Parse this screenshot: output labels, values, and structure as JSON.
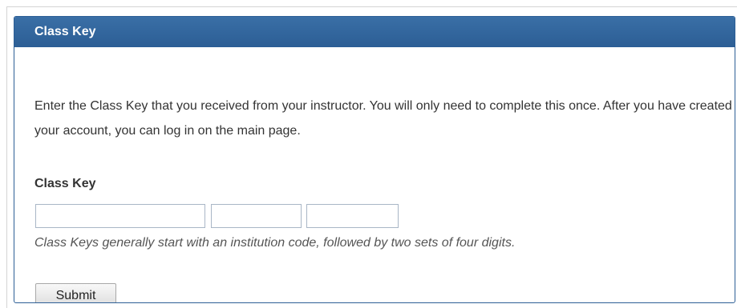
{
  "panel": {
    "title": "Class Key",
    "description": "Enter the Class Key that you received from your instructor. You will only need to complete this once. After you have created your account, you can log in on the main page.",
    "field_label": "Class Key",
    "inputs": [
      {
        "value": "",
        "placeholder": ""
      },
      {
        "value": "",
        "placeholder": ""
      },
      {
        "value": "",
        "placeholder": ""
      }
    ],
    "hint": "Class Keys generally start with an institution code, followed by two sets of four digits.",
    "submit_label": "Submit"
  },
  "colors": {
    "header_bg": "#30659d",
    "header_text": "#ffffff",
    "border": "#2d5f96"
  }
}
